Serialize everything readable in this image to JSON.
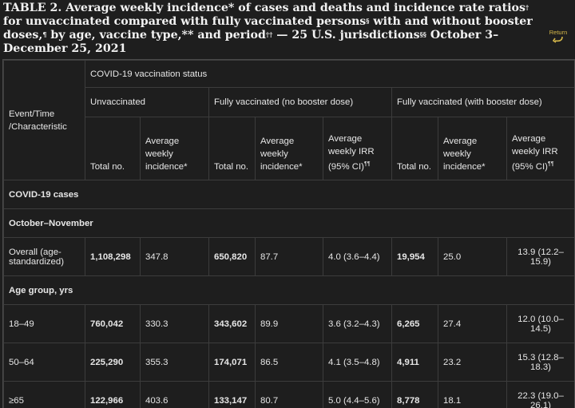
{
  "title": {
    "part1": "TABLE 2. Average weekly incidence* of cases and deaths and incidence rate ratios",
    "sup1": "†",
    "part2": " for unvaccinated compared with fully vaccinated persons",
    "sup2": "§",
    "part3": " with and without booster doses,",
    "sup3": "¶",
    "part4": " by age, vaccine type,** and period",
    "sup4": "††",
    "part5": " — 25 U.S. jurisdictions",
    "sup5": "§§",
    "part6": " October 3–December 25, 2021"
  },
  "return_label": "Return",
  "table": {
    "header": {
      "group_label": "COVID-19 vaccination status",
      "event_col": "Event/Time /Characteristic",
      "groups": [
        "Unvaccinated",
        "Fully vaccinated (no booster dose)",
        "Fully vaccinated (with booster dose)"
      ],
      "cols": {
        "total": "Total no.",
        "avg": "Average weekly incidence*",
        "irr": "Average weekly IRR (95% CI)",
        "irr_sup": "¶¶"
      }
    },
    "sections": {
      "cases": "COVID-19 cases",
      "period": "October–November",
      "age_group": "Age group, yrs"
    },
    "rows": [
      {
        "label": "Overall (age-standardized)",
        "u_total": "1,108,298",
        "u_avg": "347.8",
        "nb_total": "650,820",
        "nb_avg": "87.7",
        "nb_irr": "4.0 (3.6–4.4)",
        "b_total": "19,954",
        "b_avg": "25.0",
        "b_irr": "13.9 (12.2–15.9)"
      },
      {
        "label": "18–49",
        "u_total": "760,042",
        "u_avg": "330.3",
        "nb_total": "343,602",
        "nb_avg": "89.9",
        "nb_irr": "3.6 (3.2–4.3)",
        "b_total": "6,265",
        "b_avg": "27.4",
        "b_irr": "12.0 (10.0–14.5)"
      },
      {
        "label": "50–64",
        "u_total": "225,290",
        "u_avg": "355.3",
        "nb_total": "174,071",
        "nb_avg": "86.5",
        "nb_irr": "4.1 (3.5–4.8)",
        "b_total": "4,911",
        "b_avg": "23.2",
        "b_irr": "15.3 (12.8–18.3)"
      },
      {
        "label": "≥65",
        "u_total": "122,966",
        "u_avg": "403.6",
        "nb_total": "133,147",
        "nb_avg": "80.7",
        "nb_irr": "5.0 (4.4–5.6)",
        "b_total": "8,778",
        "b_avg": "18.1",
        "b_irr": "22.3 (19.0–26.1)"
      }
    ]
  }
}
